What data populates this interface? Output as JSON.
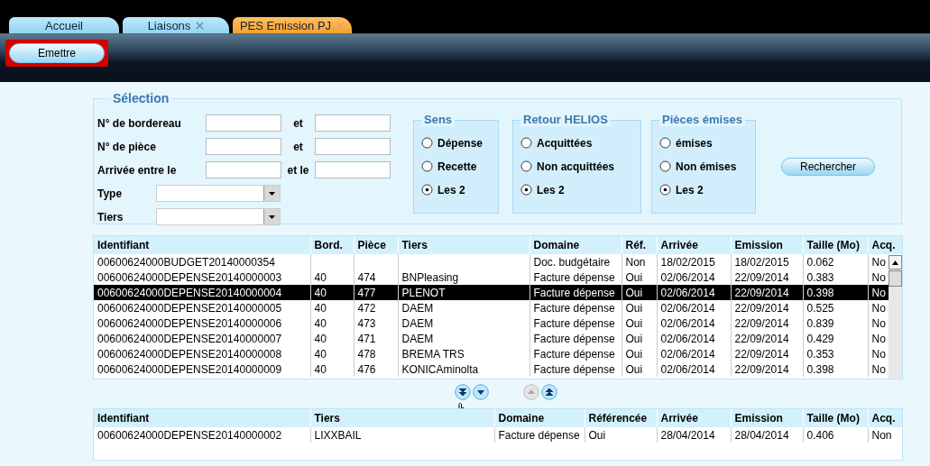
{
  "tabs": [
    {
      "label": "Accueil",
      "selected": false,
      "closable": false
    },
    {
      "label": "Liaisons",
      "selected": false,
      "closable": true
    },
    {
      "label": "PES Emission PJ",
      "selected": true,
      "closable": true
    }
  ],
  "toolbar": {
    "button": "Emettre",
    "highlighted": true
  },
  "selection": {
    "title": "Sélection",
    "fields": [
      {
        "kind": "range",
        "label": "N° de bordereau",
        "between": "et"
      },
      {
        "kind": "range",
        "label": "N° de pièce",
        "between": "et"
      },
      {
        "kind": "range",
        "label": "Arrivée entre le",
        "between": "et le"
      },
      {
        "kind": "combo",
        "label": "Type"
      },
      {
        "kind": "combo",
        "label": "Tiers"
      }
    ],
    "groups": [
      {
        "title": "Sens",
        "options": [
          {
            "label": "Dépense",
            "selected": false
          },
          {
            "label": "Recette",
            "selected": false
          },
          {
            "label": "Les 2",
            "selected": true
          }
        ]
      },
      {
        "title": "Retour HELIOS",
        "options": [
          {
            "label": "Acquittées",
            "selected": false
          },
          {
            "label": "Non acquittées",
            "selected": false
          },
          {
            "label": "Les 2",
            "selected": true
          }
        ]
      },
      {
        "title": "Pièces émises",
        "options": [
          {
            "label": "émises",
            "selected": false
          },
          {
            "label": "Non émises",
            "selected": false
          },
          {
            "label": "Les 2",
            "selected": true
          }
        ]
      }
    ],
    "search_button": "Rechercher"
  },
  "table": {
    "columns": [
      "Identifiant",
      "Bord.",
      "Pièce",
      "Tiers",
      "Domaine",
      "Réf.",
      "Arrivée",
      "Emission",
      "Taille (Mo)",
      "Acq."
    ],
    "rows": [
      {
        "selected": false,
        "cells": [
          "00600624000BUDGET20140000354",
          "",
          "",
          "",
          "Doc. budgétaire",
          "Non",
          "18/02/2015",
          "18/02/2015",
          "0.062",
          "No"
        ]
      },
      {
        "selected": false,
        "cells": [
          "00600624000DEPENSE20140000003",
          "40",
          "474",
          "BNPleasing",
          "Facture dépense",
          "Oui",
          "02/06/2014",
          "22/09/2014",
          "0.383",
          "No"
        ]
      },
      {
        "selected": true,
        "cells": [
          "00600624000DEPENSE20140000004",
          "40",
          "477",
          "PLENOT",
          "Facture dépense",
          "Oui",
          "02/06/2014",
          "22/09/2014",
          "0.398",
          "No"
        ]
      },
      {
        "selected": false,
        "cells": [
          "00600624000DEPENSE20140000005",
          "40",
          "472",
          "DAEM",
          "Facture dépense",
          "Oui",
          "02/06/2014",
          "22/09/2014",
          "0.525",
          "No"
        ]
      },
      {
        "selected": false,
        "cells": [
          "00600624000DEPENSE20140000006",
          "40",
          "473",
          "DAEM",
          "Facture dépense",
          "Oui",
          "02/06/2014",
          "22/09/2014",
          "0.839",
          "No"
        ]
      },
      {
        "selected": false,
        "cells": [
          "00600624000DEPENSE20140000007",
          "40",
          "471",
          "DAEM",
          "Facture dépense",
          "Oui",
          "02/06/2014",
          "22/09/2014",
          "0.429",
          "No"
        ]
      },
      {
        "selected": false,
        "cells": [
          "00600624000DEPENSE20140000008",
          "40",
          "478",
          "BREMA TRS",
          "Facture dépense",
          "Oui",
          "02/06/2014",
          "22/09/2014",
          "0.353",
          "No"
        ]
      },
      {
        "selected": false,
        "cells": [
          "00600624000DEPENSE20140000009",
          "40",
          "476",
          "KONICAminolta",
          "Facture dépense",
          "Oui",
          "02/06/2014",
          "22/09/2014",
          "0.398",
          "No"
        ]
      }
    ]
  },
  "move_buttons": [
    {
      "kind": "all-down",
      "disabled": false
    },
    {
      "kind": "down",
      "disabled": false
    },
    {
      "kind": "up",
      "disabled": true
    },
    {
      "kind": "all-up",
      "disabled": false
    }
  ],
  "emitted_table": {
    "columns": [
      "Identifiant",
      "Tiers",
      "Domaine",
      "Référencée",
      "Arrivée",
      "Emission",
      "Taille (Mo)",
      "Acq."
    ],
    "rows": [
      {
        "selected": false,
        "cells": [
          "00600624000DEPENSE20140000002",
          "LIXXBAIL",
          "Facture dépense",
          "Oui",
          "28/04/2014",
          "28/04/2014",
          "0.406",
          "Non"
        ]
      }
    ]
  }
}
